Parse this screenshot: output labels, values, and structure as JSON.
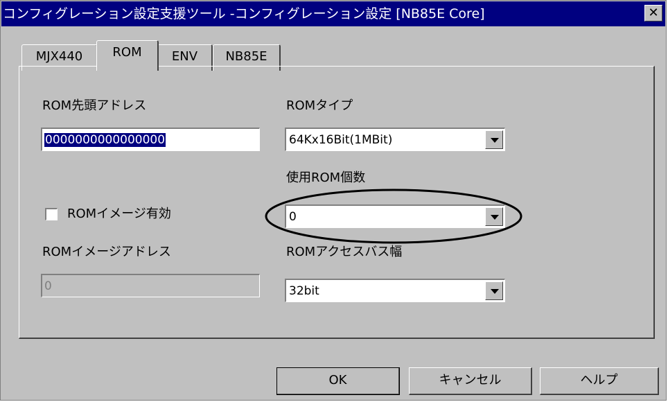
{
  "window": {
    "title": "コンフィグレーション設定支援ツール -コンフィグレーション設定 [NB85E Core]",
    "close_glyph": "✕"
  },
  "tabs": [
    {
      "label": "MJX440",
      "active": false
    },
    {
      "label": "ROM",
      "active": true
    },
    {
      "label": "ENV",
      "active": false
    },
    {
      "label": "NB85E",
      "active": false
    }
  ],
  "rom": {
    "start_address_label": "ROM先頭アドレス",
    "start_address_value": "0000000000000000",
    "rom_type_label": "ROMタイプ",
    "rom_type_value": "64Kx16Bit(1MBit)",
    "rom_count_label": "使用ROM個数",
    "rom_count_value": "0",
    "image_enable_label": "ROMイメージ有効",
    "image_enable_checked": false,
    "image_address_label": "ROMイメージアドレス",
    "image_address_value": "0",
    "bus_width_label": "ROMアクセスバス幅",
    "bus_width_value": "32bit"
  },
  "buttons": {
    "ok": "OK",
    "cancel": "キャンセル",
    "help": "ヘルプ"
  },
  "colors": {
    "titlebar": "#000080",
    "dialog_bg": "#c0c0c0",
    "selection": "#000080"
  }
}
